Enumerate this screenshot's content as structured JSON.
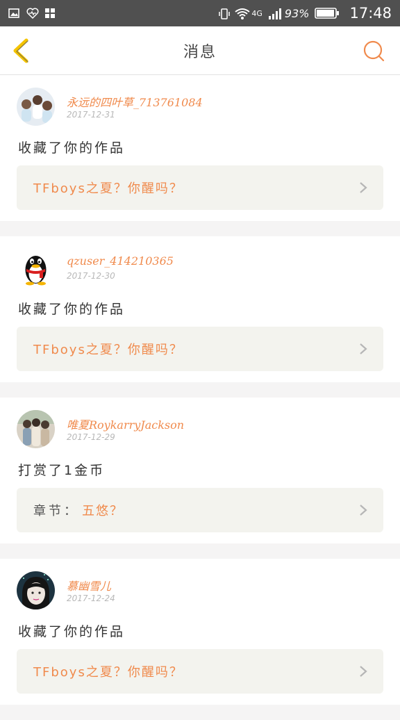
{
  "status_bar": {
    "network": "4G",
    "battery": "93%",
    "time": "17:48"
  },
  "nav": {
    "title": "消息"
  },
  "colors": {
    "accent": "#f08a4c",
    "back_arrow": "#f5c400",
    "card_bg": "#f3f3ee"
  },
  "messages": [
    {
      "username": "永远的四叶草_713761084",
      "date": "2017-12-31",
      "action": "收藏了你的作品",
      "work_prefix": "",
      "work_title": "TFboys之夏？你醒吗？"
    },
    {
      "username": "qzuser_414210365",
      "date": "2017-12-30",
      "action": "收藏了你的作品",
      "work_prefix": "",
      "work_title": "TFboys之夏？你醒吗？"
    },
    {
      "username": "唯夏RoykarryJackson",
      "date": "2017-12-29",
      "action": "打赏了1金币",
      "work_prefix": "章节：",
      "work_title": "五悠？"
    },
    {
      "username": "慕幽雪儿",
      "date": "2017-12-24",
      "action": "收藏了你的作品",
      "work_prefix": "",
      "work_title": "TFboys之夏？你醒吗？"
    }
  ]
}
